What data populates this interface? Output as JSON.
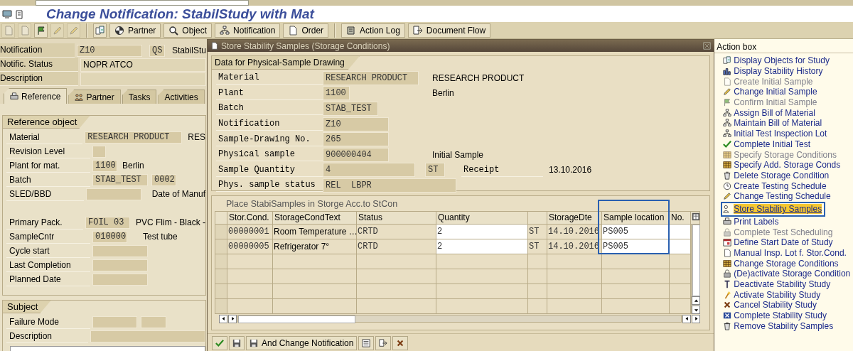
{
  "window": {
    "title": "Change Notification: StabilStudy with Mat"
  },
  "toolbar": [
    {
      "kind": "icon",
      "disabled": true
    },
    {
      "kind": "icon",
      "disabled": true
    },
    {
      "kind": "icon",
      "disabled": false
    },
    {
      "kind": "icon",
      "disabled": true
    },
    {
      "kind": "icon",
      "disabled": true
    },
    {
      "kind": "separator"
    },
    {
      "kind": "icon",
      "disabled": false
    },
    {
      "kind": "button",
      "label": "Partner",
      "disabled": false
    },
    {
      "kind": "button",
      "label": "Object",
      "disabled": false
    },
    {
      "kind": "button",
      "label": "Notification",
      "disabled": false
    },
    {
      "kind": "button",
      "label": "Order",
      "disabled": false
    },
    {
      "kind": "separator"
    },
    {
      "kind": "button",
      "label": "Action Log",
      "disabled": false
    },
    {
      "kind": "button",
      "label": "Document Flow",
      "disabled": false
    }
  ],
  "notification": {
    "header_fields": [
      {
        "label": "Notification",
        "value": "Z10",
        "code": "QS",
        "text": "StabilStu"
      },
      {
        "label": "Notific. Status",
        "value": "NOPR ATCO"
      },
      {
        "label": "Description"
      }
    ],
    "tabs": [
      {
        "label": "Reference",
        "selected": true
      },
      {
        "label": "Partner",
        "selected": false
      },
      {
        "label": "Tasks",
        "selected": false
      },
      {
        "label": "Activities",
        "selected": false
      }
    ],
    "reference_object": {
      "title": "Reference object",
      "fields": [
        {
          "label": "Material",
          "values": [
            "RESEARCH PRODUCT"
          ],
          "text": "RES"
        },
        {
          "label": "Revision Level"
        },
        {
          "label": "Plant for mat.",
          "values": [
            "1100"
          ],
          "text": "Berlin"
        },
        {
          "label": "Batch",
          "values": [
            "STAB_TEST",
            "0002"
          ]
        },
        {
          "label": "SLED/BBD",
          "text": "Date of Manuf"
        },
        {
          "label": "Primary Pack.",
          "values": [
            "FOIL 03"
          ],
          "text": "PVC Flim - Black -"
        },
        {
          "label": "SampleCntr",
          "values": [
            "010000"
          ],
          "text": "Test tube"
        },
        {
          "label": "Cycle start"
        },
        {
          "label": "Last Completion"
        },
        {
          "label": "Planned Date"
        }
      ]
    },
    "subject": {
      "title": "Subject",
      "fields": [
        {
          "label": "Failure Mode"
        },
        {
          "label": "Description"
        }
      ]
    }
  },
  "action_box": {
    "title": "Action box",
    "items": [
      {
        "label": "Display Objects for Study",
        "disabled": false,
        "selected": false
      },
      {
        "label": "Display Stability History",
        "disabled": false,
        "selected": false
      },
      {
        "label": "Create Initial Sample",
        "disabled": true,
        "selected": false
      },
      {
        "label": "Change Initial Sample",
        "disabled": false,
        "selected": false
      },
      {
        "label": "Confirm Initial Sample",
        "disabled": true,
        "selected": false
      },
      {
        "label": "Assign Bill of Material",
        "disabled": false,
        "selected": false
      },
      {
        "label": "Maintain Bill of Material",
        "disabled": false,
        "selected": false
      },
      {
        "label": "Initial Test Inspection Lot",
        "disabled": false,
        "selected": false
      },
      {
        "label": "Complete Initial Test",
        "disabled": false,
        "selected": false
      },
      {
        "label": "Specify Storage Conditions",
        "disabled": true,
        "selected": false
      },
      {
        "label": "Specify Add. Storage Conds",
        "disabled": false,
        "selected": false
      },
      {
        "label": "Delete Storage Condition",
        "disabled": false,
        "selected": false
      },
      {
        "label": "Create Testing Schedule",
        "disabled": false,
        "selected": false
      },
      {
        "label": "Change Testing Schedule",
        "disabled": false,
        "selected": false
      },
      {
        "label": "Store Stability Samples",
        "disabled": false,
        "selected": true
      },
      {
        "label": "Print Labels",
        "disabled": false,
        "selected": false
      },
      {
        "label": "Complete Test Scheduling",
        "disabled": true,
        "selected": false
      },
      {
        "label": "Define Start Date of Study",
        "disabled": false,
        "selected": false
      },
      {
        "label": "Manual Insp. Lot f. Stor.Cond.",
        "disabled": false,
        "selected": false
      },
      {
        "label": "Change Storage Conditions",
        "disabled": false,
        "selected": false
      },
      {
        "label": "(De)activate Storage Condition",
        "disabled": false,
        "selected": false
      },
      {
        "label": "Deactivate Stability Study",
        "disabled": false,
        "selected": false
      },
      {
        "label": "Activate Stability Study",
        "disabled": false,
        "selected": false
      },
      {
        "label": "Cancel Stability Study",
        "disabled": false,
        "selected": false
      },
      {
        "label": "Complete Stability Study",
        "disabled": false,
        "selected": false
      },
      {
        "label": "Remove Stability Samples",
        "disabled": false,
        "selected": false
      }
    ]
  },
  "dialog": {
    "title": "Store Stability Samples (Storage Conditions)",
    "sample_data": {
      "title": "Data for Physical-Sample Drawing",
      "rows": [
        {
          "label": "Material",
          "value": "RESEARCH PRODUCT",
          "text": "RESEARCH PRODUCT"
        },
        {
          "label": "Plant",
          "value": "1100",
          "text": "Berlin"
        },
        {
          "label": "Batch",
          "value": "STAB_TEST"
        },
        {
          "label": "Notification",
          "value": "Z10"
        },
        {
          "label": "Sample-Drawing No.",
          "value": "265"
        },
        {
          "label": "Physical sample",
          "value": "900000404",
          "text": "Initial Sample"
        },
        {
          "label": "Sample Quantity",
          "value": "4",
          "unit": "ST",
          "extra_label": "Receipt",
          "extra_value": "13.10.2016"
        },
        {
          "label": "Phys. sample status",
          "value": "REL  LBPR"
        }
      ]
    },
    "table": {
      "title": "Place StabiSamples in Storge Acc.to StCon",
      "columns": [
        {
          "label": "Stor.Cond.",
          "editable": false,
          "highlighted": false
        },
        {
          "label": "StorageCondText",
          "editable": false,
          "highlighted": false
        },
        {
          "label": "Status",
          "editable": false,
          "highlighted": false
        },
        {
          "label": "Quantity",
          "editable": true,
          "highlighted": false
        },
        {
          "editable": false,
          "highlighted": false
        },
        {
          "label": "StorageDte",
          "editable": false,
          "highlighted": false
        },
        {
          "label": "Sample location",
          "editable": true,
          "highlighted": true
        },
        {
          "label": "No.",
          "editable": true,
          "highlighted": false
        }
      ],
      "rows": [
        [
          "00000001",
          "Room Temperature …",
          "CRTD",
          "2",
          "ST",
          "14.10.2016",
          "PS005"
        ],
        [
          "00000005",
          "Refrigerator 7°",
          "CRTD",
          "2",
          "ST",
          "14.10.2016",
          "PS005"
        ]
      ]
    },
    "footer": {
      "button": "And Change Notification"
    }
  }
}
